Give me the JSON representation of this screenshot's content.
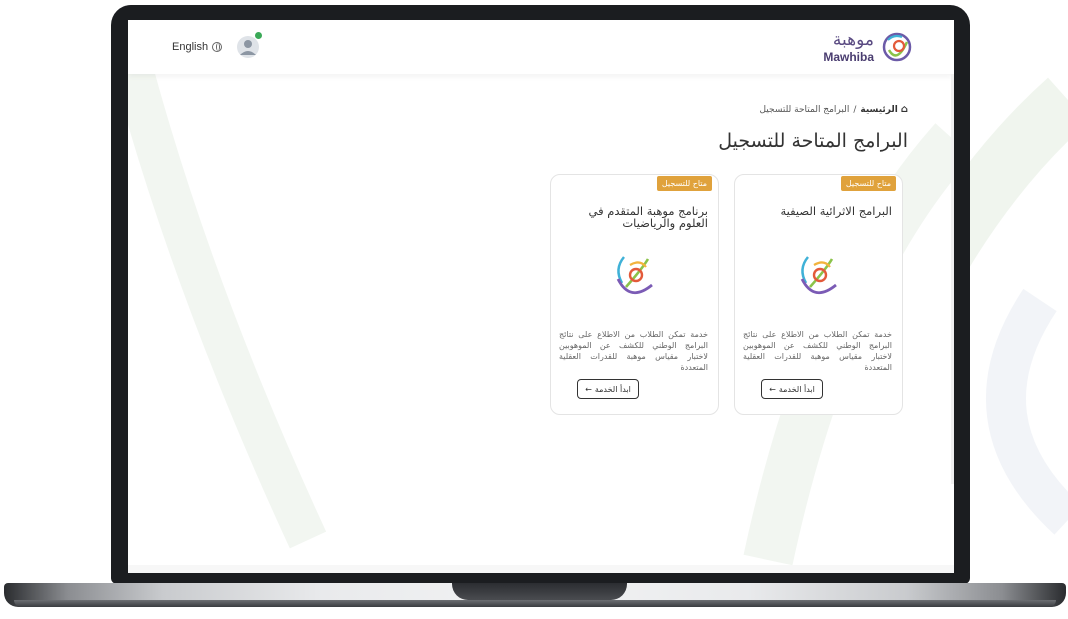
{
  "header": {
    "brand_ar": "موهبة",
    "brand_en": "Mawhiba",
    "lang_label": "English"
  },
  "breadcrumb": {
    "home": "الرئيسية",
    "separator": "/",
    "current": "البرامج المتاحة للتسجيل"
  },
  "page": {
    "title": "البرامج المتاحة للتسجيل"
  },
  "cards": [
    {
      "badge": "متاح للتسجيل",
      "title": "البرامج الاثرائية الصيفية",
      "description": "خدمة تمكن الطلاب من الاطلاع على نتائج البرامج الوطني للكشف عن الموهوبين لاختبار مقياس موهبة للقدرات العقلية المتعددة",
      "button": "ابدأ الخدمة"
    },
    {
      "badge": "متاح للتسجيل",
      "title": "برنامج موهبة المتقدم في العلوم والرياضيات",
      "description": "خدمة تمكن الطلاب من الاطلاع على نتائج البرامج الوطني للكشف عن الموهوبين لاختبار مقياس موهبة للقدرات العقلية المتعددة",
      "button": "ابدأ الخدمة"
    }
  ],
  "icons": [
    "mawhiba-logo-icon",
    "globe-icon",
    "user-avatar-icon",
    "home-icon",
    "arrow-left-icon"
  ],
  "colors": {
    "badge": "#e0a23c",
    "brand_purple": "#5a4b82",
    "status_green": "#3aa957",
    "frame": "#1b1d20"
  }
}
